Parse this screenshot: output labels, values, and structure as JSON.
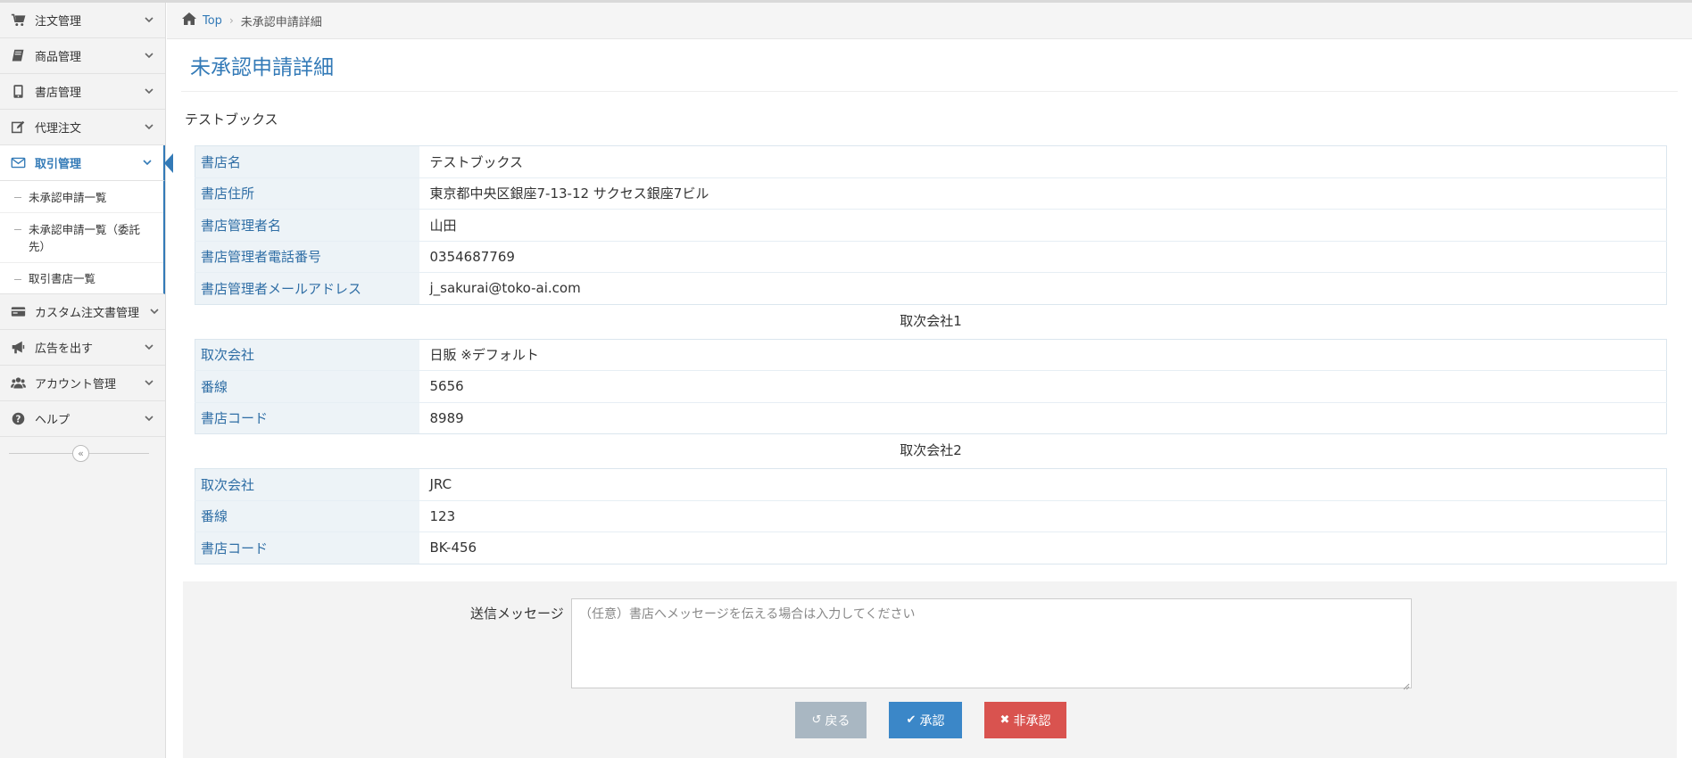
{
  "sidebar": {
    "items": [
      {
        "label": "注文管理",
        "icon": "cart-icon"
      },
      {
        "label": "商品管理",
        "icon": "book-icon"
      },
      {
        "label": "書店管理",
        "icon": "tablet-icon"
      },
      {
        "label": "代理注文",
        "icon": "edit-icon"
      },
      {
        "label": "取引管理",
        "icon": "envelope-icon"
      },
      {
        "label": "カスタム注文書管理",
        "icon": "card-icon"
      },
      {
        "label": "広告を出す",
        "icon": "bullhorn-icon"
      },
      {
        "label": "アカウント管理",
        "icon": "users-icon"
      },
      {
        "label": "ヘルプ",
        "icon": "question-icon"
      }
    ],
    "subitems": [
      "未承認申請一覧",
      "未承認申請一覧（委託先）",
      "取引書店一覧"
    ],
    "collapse_symbol": "«"
  },
  "breadcrumb": {
    "top": "Top",
    "separator": "›",
    "current": "未承認申請詳細"
  },
  "page": {
    "title": "未承認申請詳細",
    "store_heading": "テストブックス"
  },
  "store_info": [
    {
      "label": "書店名",
      "value": "テストブックス"
    },
    {
      "label": "書店住所",
      "value": "東京都中央区銀座7-13-12  サクセス銀座7ビル"
    },
    {
      "label": "書店管理者名",
      "value": "山田"
    },
    {
      "label": "書店管理者電話番号",
      "value": "0354687769"
    },
    {
      "label": "書店管理者メールアドレス",
      "value": "j_sakurai@toko-ai.com"
    }
  ],
  "distributor1": {
    "heading": "取次会社1",
    "rows": [
      {
        "label": "取次会社",
        "value": "日販  ※デフォルト"
      },
      {
        "label": "番線",
        "value": "5656"
      },
      {
        "label": "書店コード",
        "value": "8989"
      }
    ]
  },
  "distributor2": {
    "heading": "取次会社2",
    "rows": [
      {
        "label": "取次会社",
        "value": "JRC"
      },
      {
        "label": "番線",
        "value": "123"
      },
      {
        "label": "書店コード",
        "value": "BK-456"
      }
    ]
  },
  "message": {
    "label": "送信メッセージ",
    "placeholder": "（任意）書店へメッセージを伝える場合は入力してください",
    "value": ""
  },
  "buttons": {
    "back": "戻る",
    "approve": "承認",
    "reject": "非承認"
  },
  "colors": {
    "primary": "#337ab7",
    "approve": "#3b87c8",
    "reject": "#d9534f",
    "back": "#a9b7c2"
  }
}
